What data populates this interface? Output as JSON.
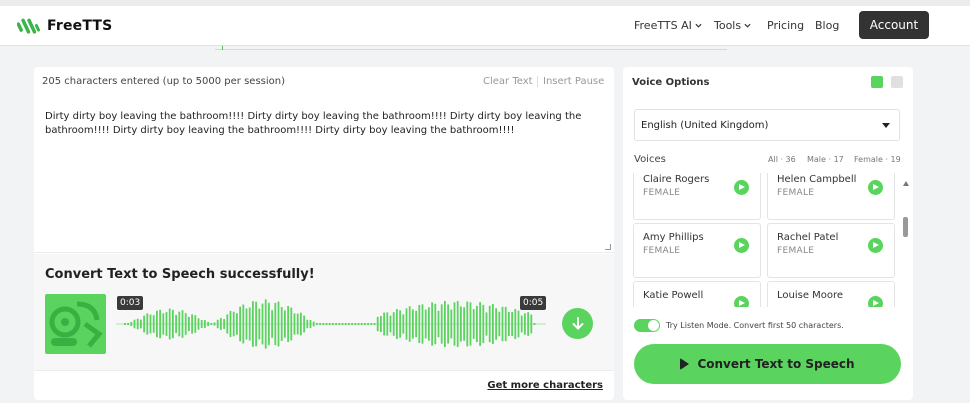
{
  "header": {
    "logo_text": "FreeTTS",
    "nav": [
      {
        "label": "FreeTTS AI",
        "has_dropdown": true
      },
      {
        "label": "Tools",
        "has_dropdown": true
      },
      {
        "label": "Pricing",
        "has_dropdown": false
      },
      {
        "label": "Blog",
        "has_dropdown": false
      }
    ],
    "account_label": "Account"
  },
  "editor": {
    "char_count": "205 characters entered (up to 5000 per session)",
    "clear_label": "Clear Text",
    "insert_pause_label": "Insert Pause",
    "text": "Dirty dirty boy leaving the bathroom!!!! Dirty dirty boy leaving the bathroom!!!! Dirty dirty boy leaving the bathroom!!!! Dirty dirty boy leaving the bathroom!!!! Dirty dirty boy leaving the bathroom!!!!"
  },
  "result": {
    "title": "Convert Text to Speech successfully!",
    "time_start": "0:03",
    "time_end": "0:05",
    "more_chars_link": "Get more characters"
  },
  "voice_options": {
    "title": "Voice Options",
    "language": "English (United Kingdom)",
    "voices_label": "Voices",
    "filters": {
      "all": "All · 36",
      "male": "Male · 17",
      "female": "Female · 19"
    },
    "voices": [
      {
        "name": "Claire Rogers",
        "gender": "FEMALE"
      },
      {
        "name": "Helen Campbell",
        "gender": "FEMALE"
      },
      {
        "name": "Amy Phillips",
        "gender": "FEMALE"
      },
      {
        "name": "Rachel Patel",
        "gender": "FEMALE"
      },
      {
        "name": "Katie Powell",
        "gender": ""
      },
      {
        "name": "Louise Moore",
        "gender": ""
      }
    ],
    "listen_mode_label": "Try Listen Mode. Convert first 50 characters.",
    "listen_mode_on": true,
    "convert_label": "Convert Text to Speech"
  },
  "colors": {
    "accent": "#5ad45f",
    "dark": "#333333"
  },
  "icons": [
    "logo-icon",
    "chevron-down-icon",
    "download-icon",
    "play-icon",
    "caret-down-icon",
    "scroll-up-icon"
  ]
}
